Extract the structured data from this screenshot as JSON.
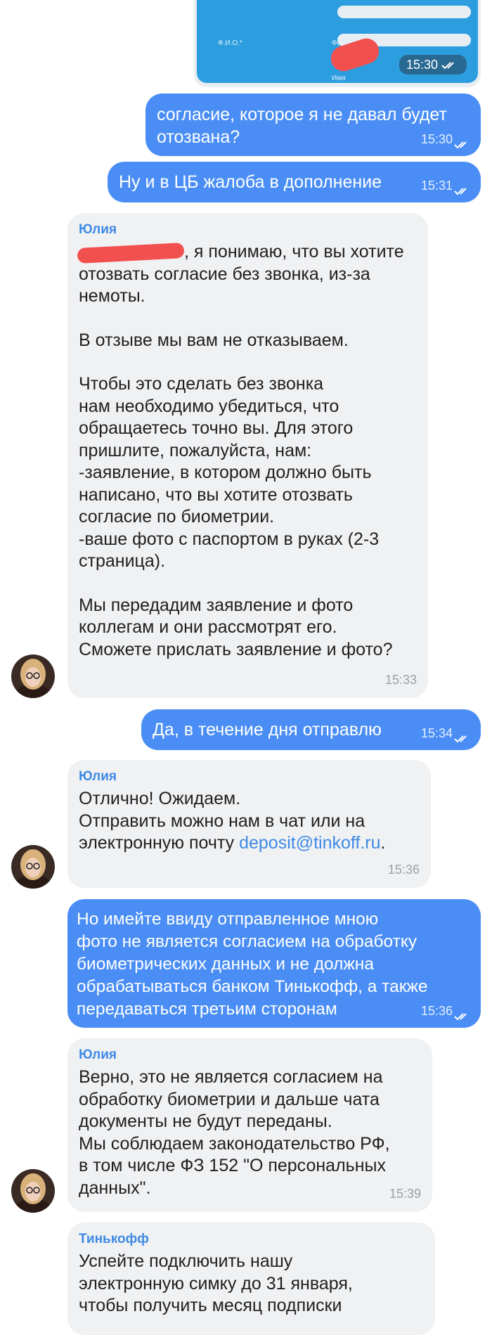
{
  "theme": {
    "outgoing_bubble": "#4a8ef5",
    "incoming_bubble": "#f0f1f3",
    "sender_name": "#3f8ae6",
    "link": "#3f8ae6",
    "redaction": "#f2504f"
  },
  "photo_message": {
    "field_label": "Ф.И.О.*",
    "field_surname": "Фамилия",
    "field_name": "Имя",
    "time": "15:30"
  },
  "messages": [
    {
      "direction": "out",
      "text": "согласие, которое я не давал будет\nотозвана?",
      "time": "15:30"
    },
    {
      "direction": "out",
      "text": "Ну и в ЦБ жалоба в дополнение",
      "time": "15:31"
    },
    {
      "direction": "in",
      "sender": "Юлия",
      "paragraphs": [
        ", я понимаю, что вы хотите\nотозвать согласие без звонка, из-за\nнемоты.",
        "В отзыве мы вам не отказываем.",
        "Чтобы это сделать без звонка\nнам необходимо убедиться, что\nобращаетесь точно вы. Для этого\nпришлите, пожалуйста, нам:\n-заявление, в котором должно быть\nнаписано, что вы хотите отозвать\nсогласие по биометрии.\n-ваше фото с паспортом в руках (2-3\nстраница).",
        "Мы передадим заявление и фото\nколлегам и они рассмотрят его.\nСможете прислать заявление и фото?"
      ],
      "time": "15:33"
    },
    {
      "direction": "out",
      "text": "Да, в течение дня отправлю",
      "time": "15:34"
    },
    {
      "direction": "in",
      "sender": "Юлия",
      "text_before_link": "Отлично! Ожидаем.\nОтправить можно нам в чат или на\nэлектронную почту ",
      "link": "deposit@tinkoff.ru",
      "text_after_link": ".",
      "time": "15:36"
    },
    {
      "direction": "out",
      "text": "Но имейте ввиду отправленное мною\nфото не является согласием на обработку\nбиометрических данных и не должна\nобрабатываться банком Тинькофф, а также\nпередаваться третьим сторонам",
      "time": "15:36"
    },
    {
      "direction": "in",
      "sender": "Юлия",
      "text": "Верно, это не является согласием на\nобработку биометрии и дальше чата\nдокументы не будут переданы.\nМы соблюдаем законодательство РФ,\nв том числе ФЗ 152 \"О персональных\nданных\".",
      "time": "15:39"
    },
    {
      "direction": "in",
      "sender": "Тинькофф",
      "text": "Успейте подключить нашу\nэлектронную симку до 31 января,\nчтобы получить месяц подписки"
    }
  ]
}
